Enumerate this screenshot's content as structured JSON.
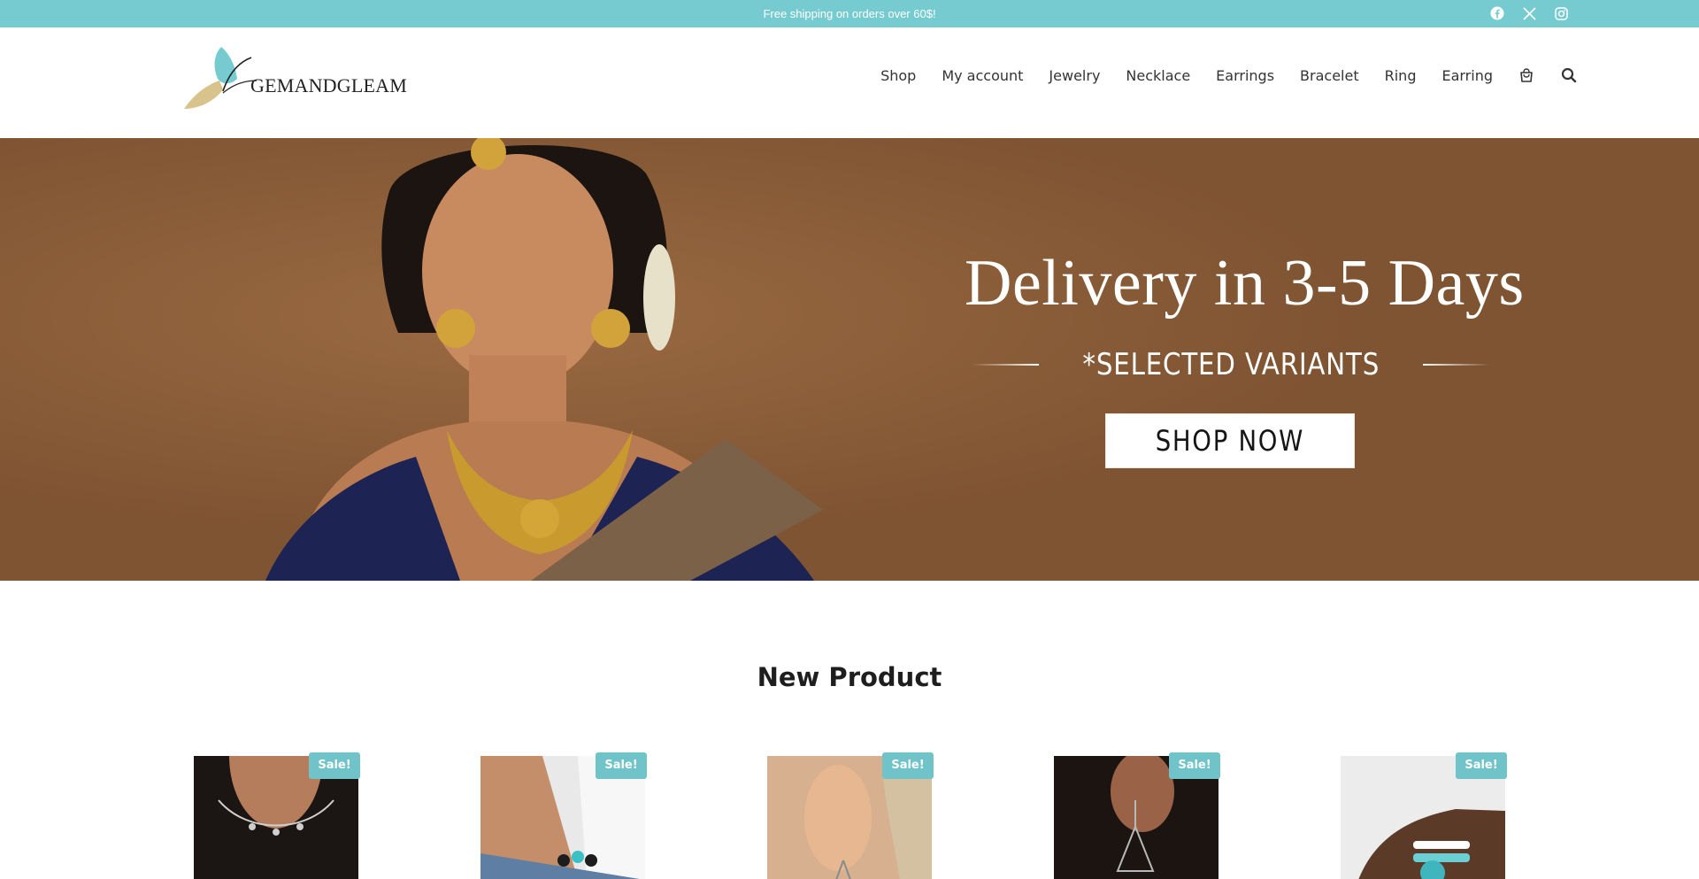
{
  "topbar": {
    "promo": "Free shipping on orders over 60$!",
    "social": [
      "facebook-icon",
      "x-icon",
      "instagram-icon"
    ]
  },
  "header": {
    "logo_text": "GEMANDGLEAM",
    "nav": [
      "Shop",
      "My account",
      "Jewelry",
      "Necklace",
      "Earrings",
      "Bracelet",
      "Ring",
      "Earring"
    ],
    "icons": [
      "cart-icon",
      "search-icon"
    ]
  },
  "hero": {
    "title": "Delivery in 3-5 Days",
    "subtitle": "*SELECTED VARIANTS",
    "button": "SHOP NOW"
  },
  "section": {
    "title": "New Product"
  },
  "products": [
    {
      "badge": "Sale!",
      "image": "necklace-on-neck"
    },
    {
      "badge": "Sale!",
      "image": "bracelet-on-wrist"
    },
    {
      "badge": "Sale!",
      "image": "earring-on-ear"
    },
    {
      "badge": "Sale!",
      "image": "drop-earring"
    },
    {
      "badge": "Sale!",
      "image": "turquoise-bracelet"
    }
  ],
  "colors": {
    "topbar": "#76cbd0",
    "hero_bg": "#7f5432",
    "sale_badge": "#6fc3c9"
  }
}
